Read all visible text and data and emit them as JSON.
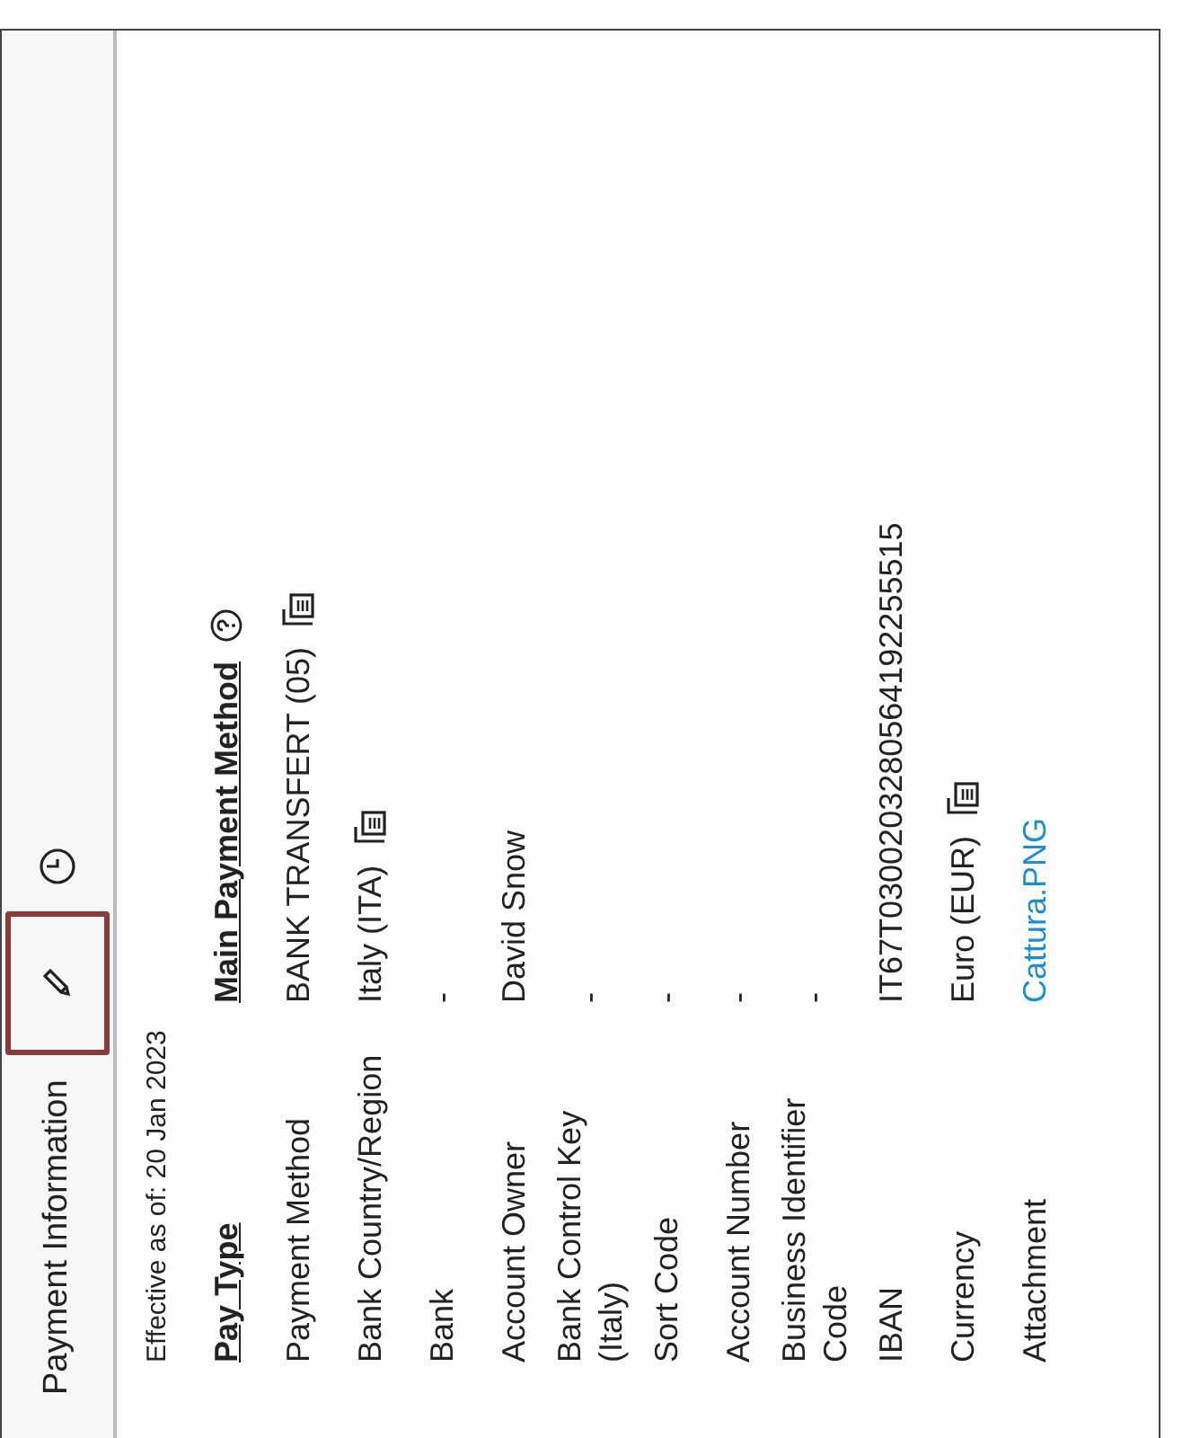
{
  "header": {
    "title": "Payment Information"
  },
  "effective": "Effective as of: 20 Jan 2023",
  "rows": [
    {
      "kind": "header",
      "label": "Pay Type",
      "value": "Main Payment Method",
      "help": true,
      "details": false
    },
    {
      "kind": "text",
      "label": "Payment Method",
      "value": "BANK TRANSFERT (05)",
      "details": true
    },
    {
      "kind": "text",
      "label": "Bank Country/Region",
      "value": "Italy (ITA)",
      "details": true
    },
    {
      "kind": "text",
      "label": "Bank",
      "value": "-",
      "details": false
    },
    {
      "kind": "text",
      "label": "Account Owner",
      "value": "David Snow",
      "details": false
    },
    {
      "kind": "text",
      "label": "Bank Control Key (Italy)",
      "value": "-",
      "details": false
    },
    {
      "kind": "text",
      "label": "Sort Code",
      "value": "-",
      "details": false
    },
    {
      "kind": "text",
      "label": "Account Number",
      "value": "-",
      "details": false
    },
    {
      "kind": "text",
      "label": "Business Identifier Code",
      "value": "-",
      "details": false
    },
    {
      "kind": "text",
      "label": "IBAN",
      "value": "IT67T0300203280564192255515",
      "details": false
    },
    {
      "kind": "text",
      "label": "Currency",
      "value": "Euro (EUR)",
      "details": true
    },
    {
      "kind": "link",
      "label": "Attachment",
      "value": "Cattura.PNG",
      "details": false
    }
  ]
}
